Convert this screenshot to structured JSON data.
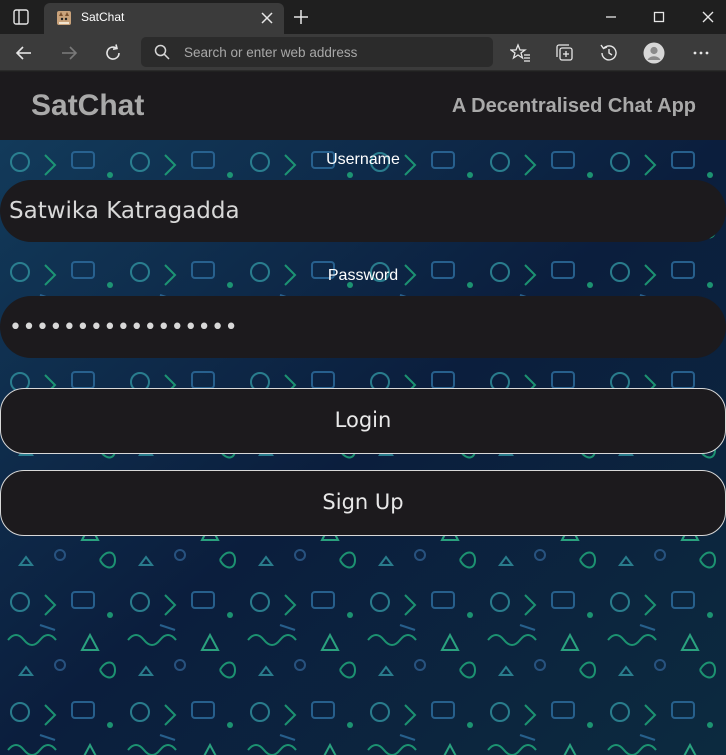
{
  "browser": {
    "tab_title": "SatChat",
    "address_placeholder": "Search or enter web address"
  },
  "app": {
    "brand": "SatChat",
    "tagline": "A Decentralised Chat App"
  },
  "form": {
    "username_label": "Username",
    "username_value": "Satwika Katragadda",
    "password_label": "Password",
    "password_value": "•••••••••••••••••",
    "login_label": "Login",
    "signup_label": "Sign Up"
  },
  "colors": {
    "header_bg": "#1c1a1d",
    "pattern_bg": "#0d1a33",
    "pattern_green": "#1fa67a",
    "pattern_blue": "#2c5a8a"
  }
}
